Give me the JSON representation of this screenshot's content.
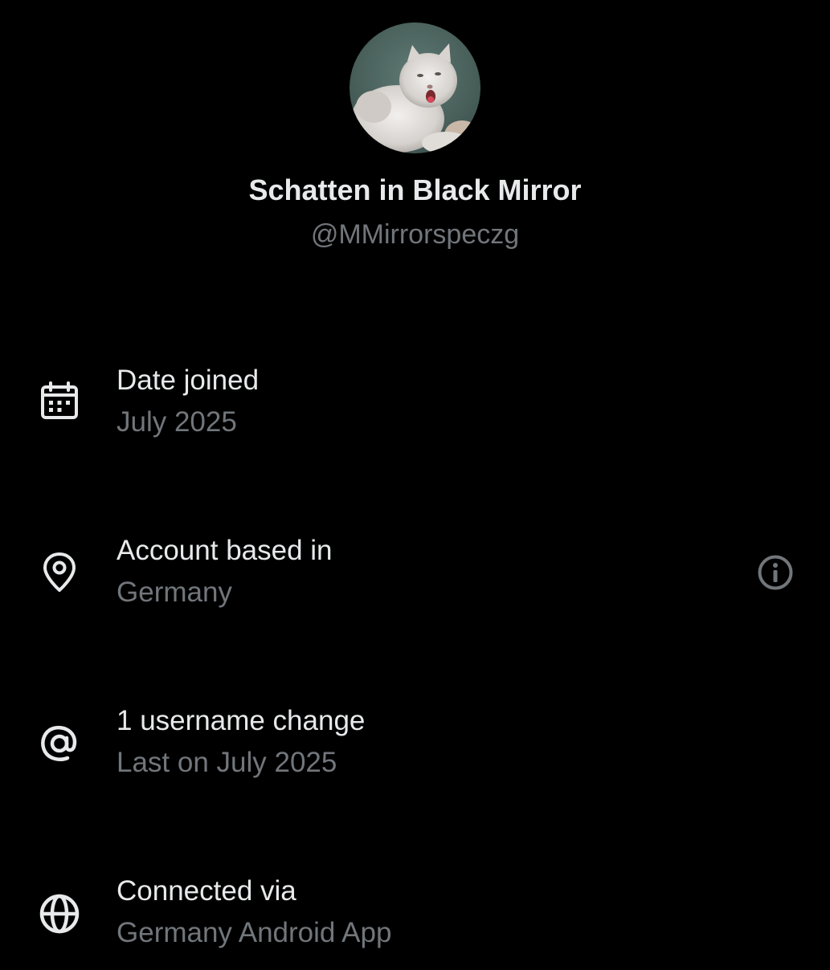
{
  "profile": {
    "display_name": "Schatten in Black Mirror",
    "handle": "@MMirrorspeczg",
    "avatar_description": "white-persian-cat-photo"
  },
  "about": {
    "rows": [
      {
        "icon": "calendar-icon",
        "title": "Date joined",
        "value": "July 2025"
      },
      {
        "icon": "location-pin-icon",
        "title": "Account based in",
        "value": "Germany",
        "has_info_button": true
      },
      {
        "icon": "at-sign-icon",
        "title": "1 username change",
        "value": "Last on July 2025"
      },
      {
        "icon": "globe-icon",
        "title": "Connected via",
        "value": "Germany Android App"
      }
    ]
  },
  "colors": {
    "background": "#000000",
    "primary_text": "#e7e9ea",
    "secondary_text": "#71767b",
    "info_icon": "#71767b"
  }
}
